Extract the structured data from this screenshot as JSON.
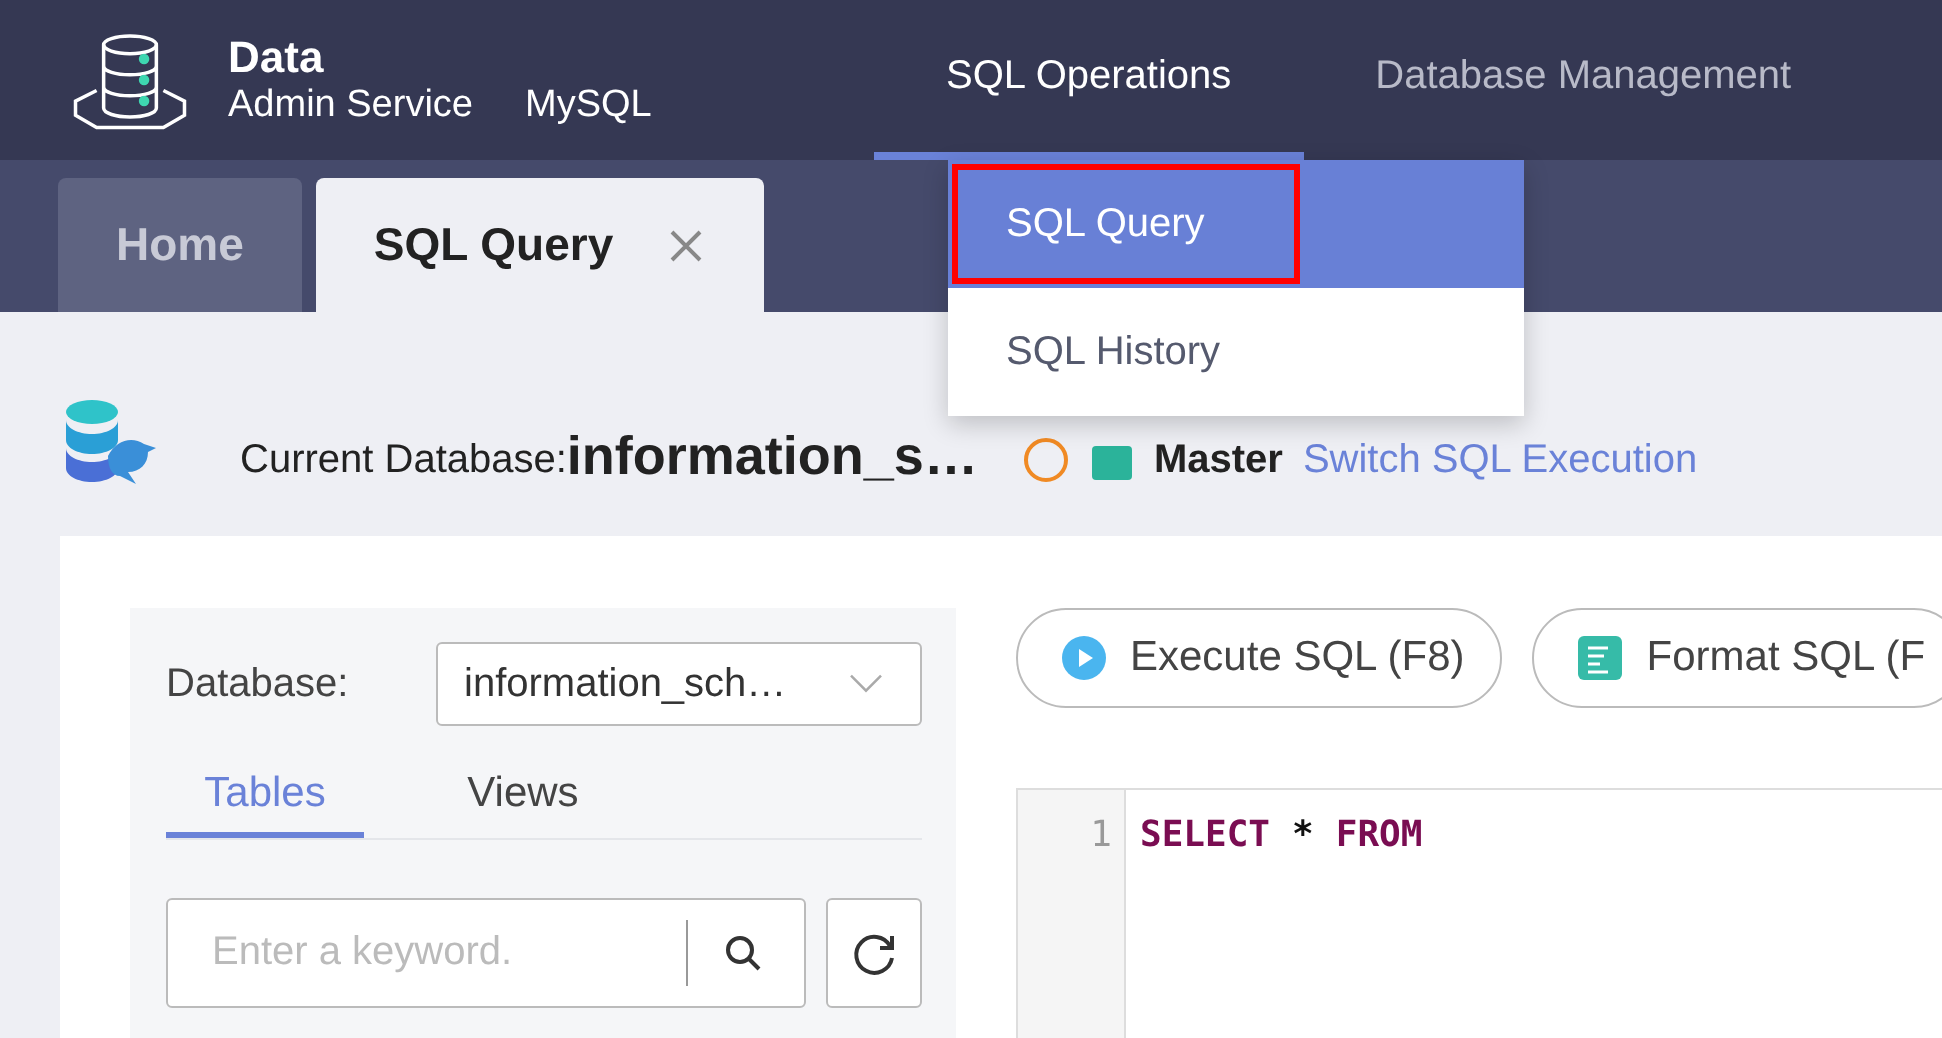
{
  "brand": {
    "title": "Data",
    "subtitle": "Admin Service",
    "engine": "MySQL"
  },
  "nav": [
    {
      "label": "SQL Operations",
      "selected": true
    },
    {
      "label": "Database Management",
      "selected": false
    }
  ],
  "nav_menu": [
    {
      "label": "SQL Query",
      "selected": true,
      "highlighted": true
    },
    {
      "label": "SQL History",
      "selected": false,
      "highlighted": false
    }
  ],
  "tabs": [
    {
      "label": "Home",
      "selected": false,
      "closable": false
    },
    {
      "label": "SQL Query",
      "selected": true,
      "closable": true
    }
  ],
  "info": {
    "label": "Current Database:",
    "database": "information_s…",
    "node": "Master",
    "link": "Switch SQL Execution"
  },
  "sidebar": {
    "database_label": "Database:",
    "database_value": "information_sch…",
    "tabs": [
      {
        "label": "Tables",
        "selected": true
      },
      {
        "label": "Views",
        "selected": false
      }
    ],
    "search": {
      "placeholder": "Enter a keyword."
    }
  },
  "toolbar": [
    {
      "kind": "execute",
      "label": "Execute SQL (F8)"
    },
    {
      "kind": "format",
      "label": "Format SQL (F"
    }
  ],
  "editor": {
    "lines": [
      {
        "number": "1",
        "tokens": [
          {
            "kind": "keyword",
            "text": "SELECT"
          },
          {
            "kind": "operator",
            "text": "*"
          },
          {
            "kind": "keyword",
            "text": "FROM"
          }
        ]
      }
    ]
  }
}
